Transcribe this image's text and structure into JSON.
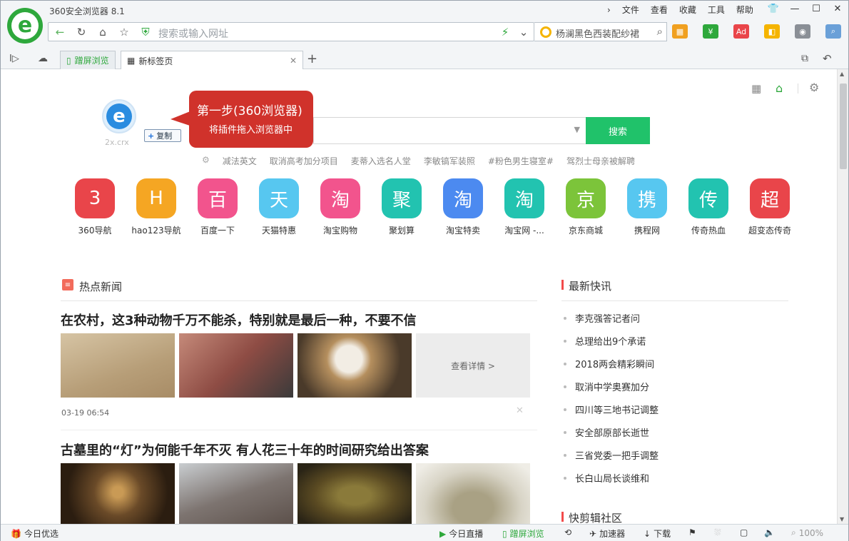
{
  "app": {
    "title": "360安全浏览器 8.1"
  },
  "menu": [
    "文件",
    "查看",
    "收藏",
    "工具",
    "帮助"
  ],
  "address": {
    "placeholder": "搜索或输入网址"
  },
  "search_box": {
    "value": "杨澜黑色西装配纱裙"
  },
  "tabs": [
    {
      "label": "蹭屏浏览"
    },
    {
      "label": "新标签页"
    }
  ],
  "tooltip": {
    "title": "第一步(360浏览器)",
    "subtitle": "将插件拖入浏览器中",
    "copy_label": "复制",
    "ext_name": "2x.crx"
  },
  "search": {
    "button": "搜索"
  },
  "hot_keywords": [
    "减法英文",
    "取消高考加分项目",
    "麦蒂入选名人堂",
    "李敏镐军装照",
    "#粉色男生寝室#",
    "驾烈士母亲被解聘"
  ],
  "sites": [
    {
      "glyph": "3",
      "label": "360导航",
      "color": "#e9454a"
    },
    {
      "glyph": "H",
      "label": "hao123导航",
      "color": "#f5a623"
    },
    {
      "glyph": "百",
      "label": "百度一下",
      "color": "#f2548d"
    },
    {
      "glyph": "天",
      "label": "天猫特惠",
      "color": "#57c7f0"
    },
    {
      "glyph": "淘",
      "label": "淘宝购物",
      "color": "#f2548d"
    },
    {
      "glyph": "聚",
      "label": "聚划算",
      "color": "#22c3b0"
    },
    {
      "glyph": "淘",
      "label": "淘宝特卖",
      "color": "#4c8af0"
    },
    {
      "glyph": "淘",
      "label": "淘宝网 -...",
      "color": "#22c3b0"
    },
    {
      "glyph": "京",
      "label": "京东商城",
      "color": "#7cc43a"
    },
    {
      "glyph": "携",
      "label": "携程网",
      "color": "#57c7f0"
    },
    {
      "glyph": "传",
      "label": "传奇热血",
      "color": "#22c3b0"
    },
    {
      "glyph": "超",
      "label": "超变态传奇",
      "color": "#e9454a"
    }
  ],
  "news": {
    "section_title": "热点新闻",
    "items": [
      {
        "headline": "在农村，这3种动物千万不能杀，特别就是最后一种，不要不信",
        "more": "查看详情 >",
        "time": "03-19 06:54"
      },
      {
        "headline": "古墓里的“灯”为何能千年不灭 有人花三十年的时间研究给出答案"
      }
    ]
  },
  "flash": {
    "title": "最新快讯",
    "items": [
      "李克强答记者问",
      "总理给出9个承诺",
      "2018两会精彩瞬间",
      "取消中学奥赛加分",
      "四川等三地书记调整",
      "安全部原部长逝世",
      "三省党委一把手调整",
      "长白山局长谈维和"
    ],
    "next_title": "快剪辑社区"
  },
  "status": {
    "today": "今日优选",
    "live": "今日直播",
    "split": "蹭屏浏览",
    "accelerator": "加速器",
    "download": "下载",
    "zoom": "100%"
  }
}
